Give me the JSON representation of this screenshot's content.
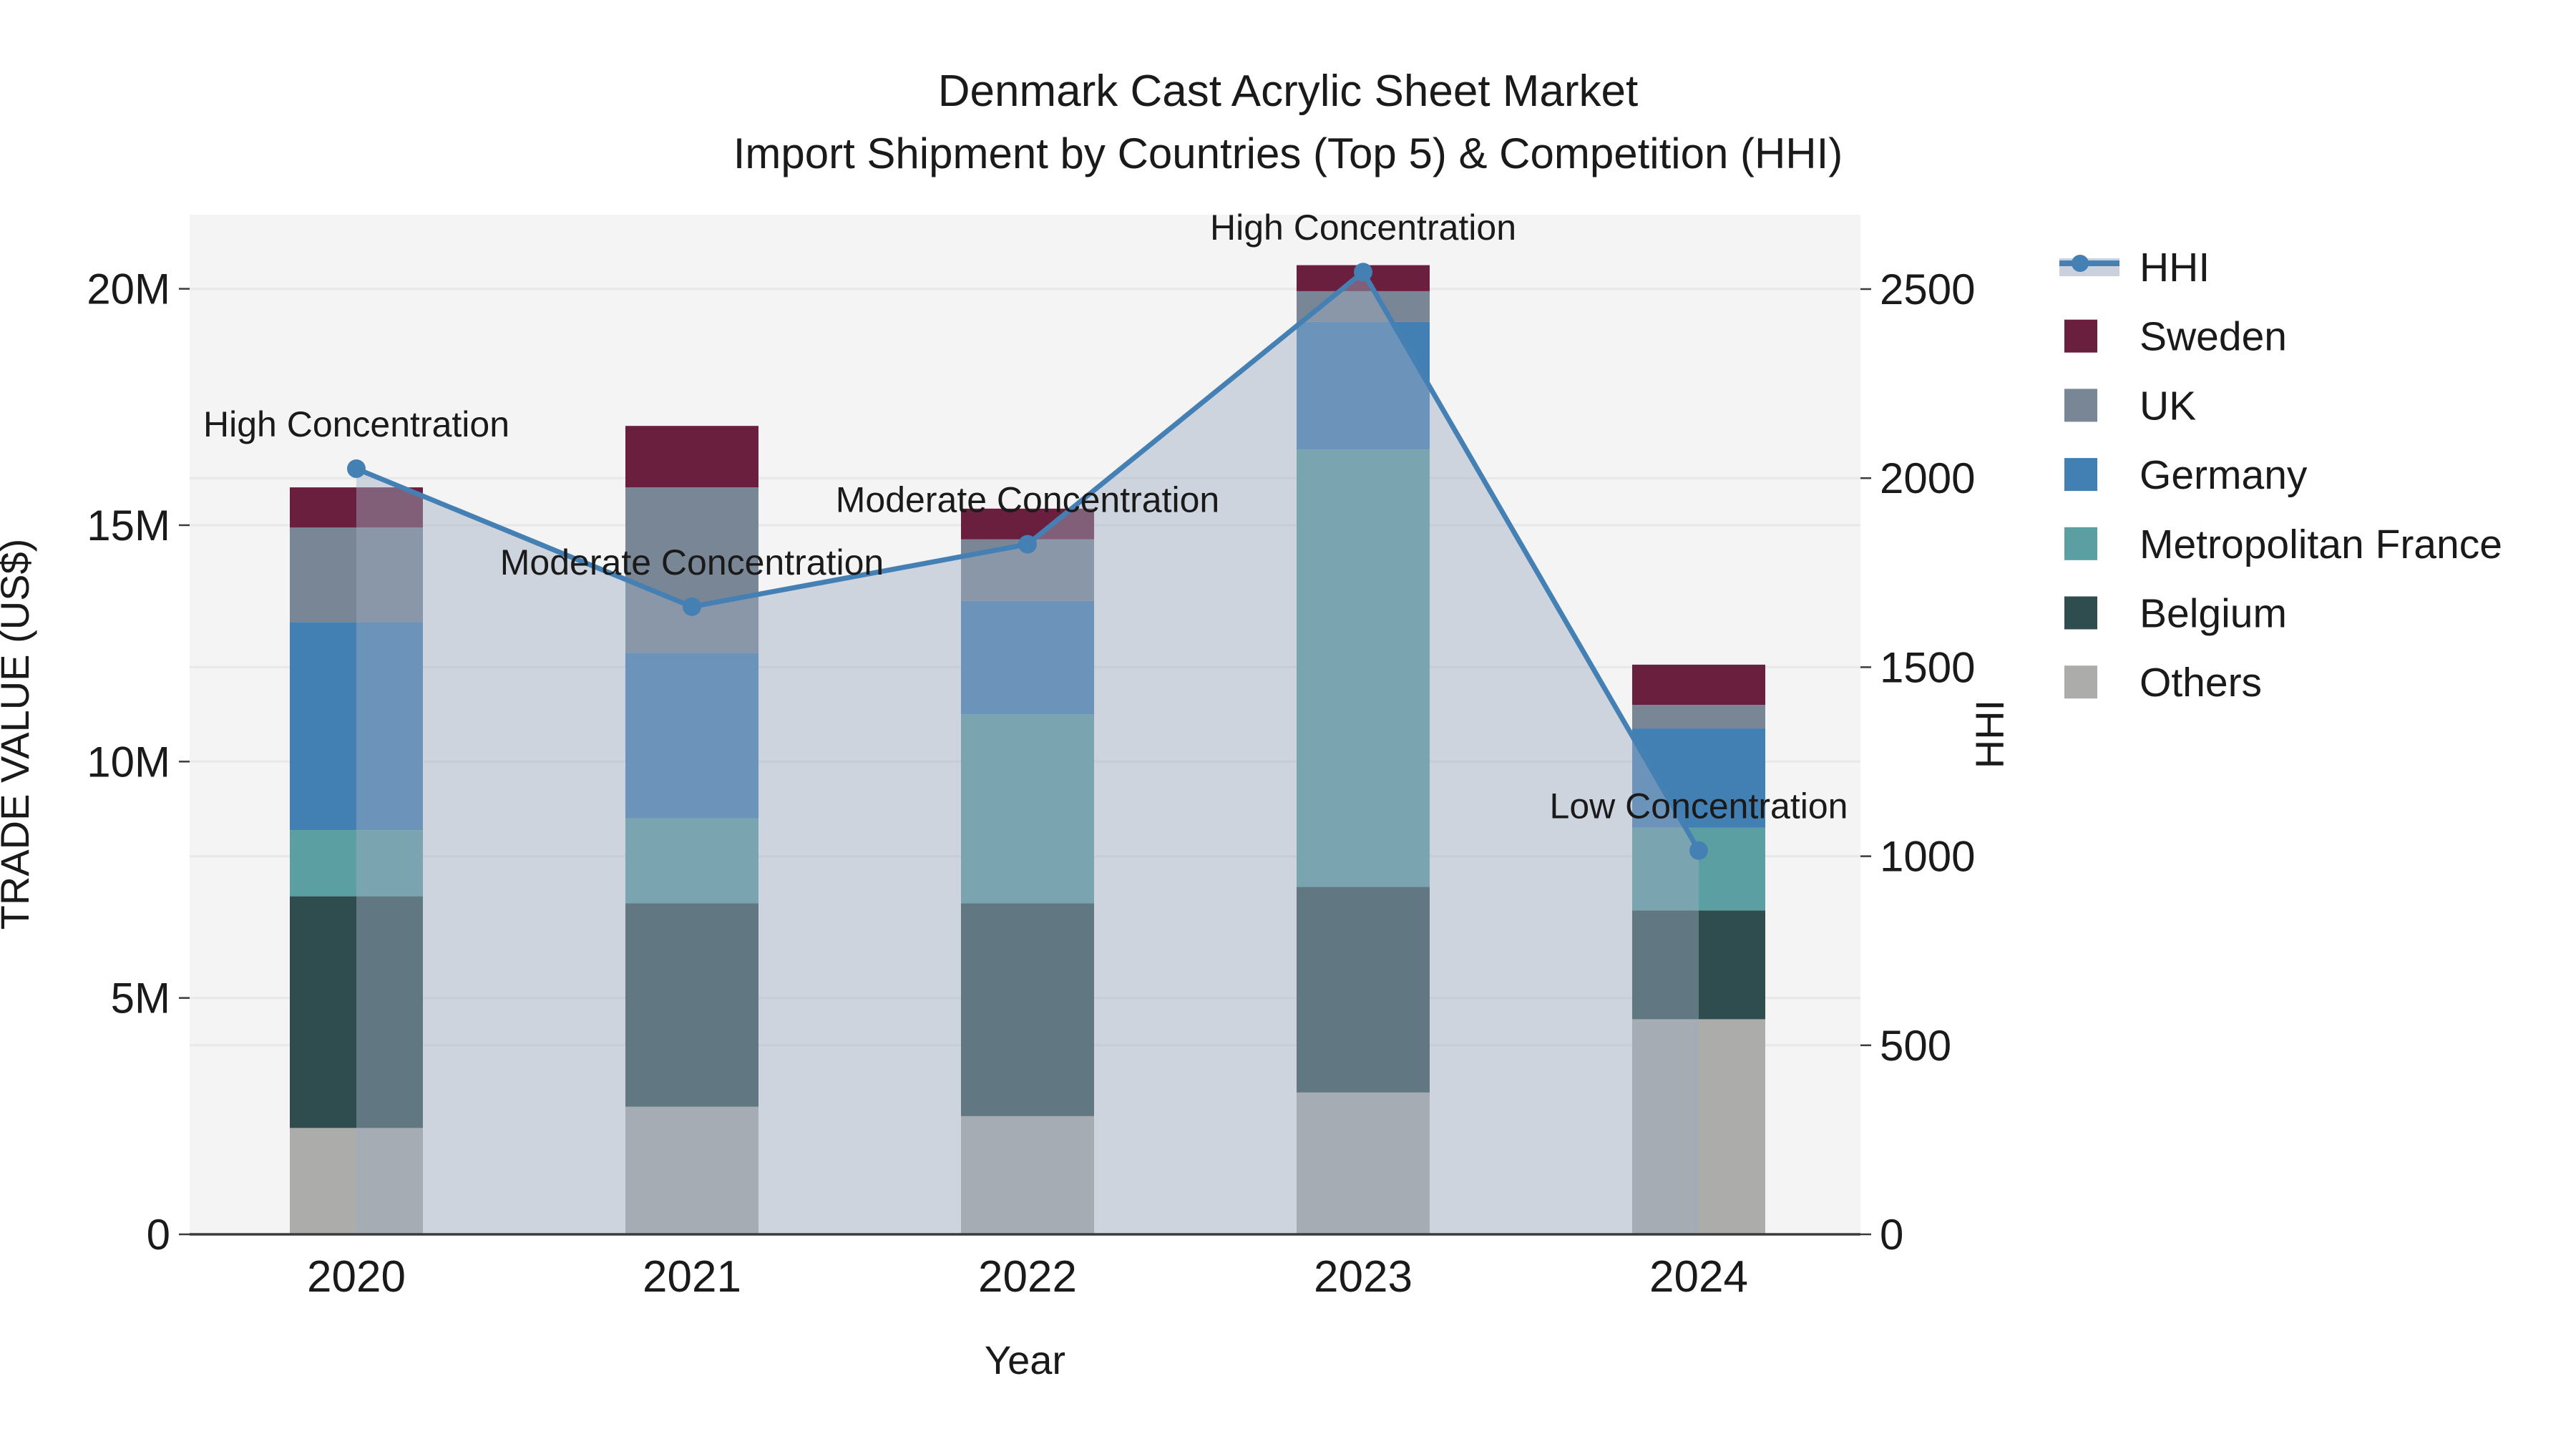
{
  "title": {
    "line1": "Denmark Cast Acrylic Sheet Market",
    "line2": "Import Shipment by Countries (Top 5) & Competition (HHI)"
  },
  "chart_data": {
    "type": "bar+line",
    "x_label": "Year",
    "y_left_label": "TRADE VALUE (US$)",
    "y_right_label": "HHI",
    "categories": [
      "2020",
      "2021",
      "2022",
      "2023",
      "2024"
    ],
    "stack_order": [
      "Others",
      "Belgium",
      "Metropolitan France",
      "Germany",
      "UK",
      "Sweden"
    ],
    "series": [
      {
        "name": "Sweden",
        "color": "#6B1F3F",
        "values": [
          0.85,
          1.3,
          0.65,
          0.55,
          0.85
        ]
      },
      {
        "name": "UK",
        "color": "#788695",
        "values": [
          2.0,
          3.5,
          1.3,
          0.65,
          0.5
        ]
      },
      {
        "name": "Germany",
        "color": "#4280B4",
        "values": [
          4.4,
          3.5,
          2.4,
          2.7,
          2.1
        ]
      },
      {
        "name": "Metropolitan France",
        "color": "#5C9FA2",
        "values": [
          1.4,
          1.8,
          4.0,
          9.25,
          1.75
        ]
      },
      {
        "name": "Belgium",
        "color": "#2F4D4F",
        "values": [
          4.9,
          4.3,
          4.5,
          4.35,
          2.3
        ]
      },
      {
        "name": "Others",
        "color": "#ACACAA",
        "values": [
          2.25,
          2.7,
          2.5,
          3.0,
          4.55
        ]
      }
    ],
    "bar_totals_millions": [
      15.8,
      17.1,
      15.35,
      20.5,
      12.05
    ],
    "line_series": {
      "name": "HHI",
      "color": "#4580B5",
      "area_fill": "rgba(160,172,192,0.45)",
      "values": [
        2025,
        1660,
        1825,
        2545,
        1015
      ]
    },
    "annotations": [
      {
        "year": "2020",
        "text": "High Concentration"
      },
      {
        "year": "2021",
        "text": "Moderate Concentration"
      },
      {
        "year": "2022",
        "text": "Moderate Concentration"
      },
      {
        "year": "2023",
        "text": "High Concentration"
      },
      {
        "year": "2024",
        "text": "Low Concentration"
      }
    ],
    "y_left_ticks": [
      {
        "value": 0,
        "label": "0"
      },
      {
        "value": 5,
        "label": "5M"
      },
      {
        "value": 10,
        "label": "10M"
      },
      {
        "value": 15,
        "label": "15M"
      },
      {
        "value": 20,
        "label": "20M"
      }
    ],
    "y_right_ticks": [
      {
        "value": 0,
        "label": "0"
      },
      {
        "value": 500,
        "label": "500"
      },
      {
        "value": 1000,
        "label": "1000"
      },
      {
        "value": 1500,
        "label": "1500"
      },
      {
        "value": 2000,
        "label": "2000"
      },
      {
        "value": 2500,
        "label": "2500"
      }
    ],
    "y_left_range_millions": [
      0,
      21.6
    ],
    "y_right_range": [
      0,
      2697
    ],
    "grid": true,
    "legend_position": "right",
    "legend": [
      "HHI",
      "Sweden",
      "UK",
      "Germany",
      "Metropolitan France",
      "Belgium",
      "Others"
    ],
    "colors": {
      "plot_background": "#F4F4F4",
      "gridline": "#E7E8EA",
      "axis_line": "#3B3B3B",
      "text": "#1A1A1A"
    }
  }
}
